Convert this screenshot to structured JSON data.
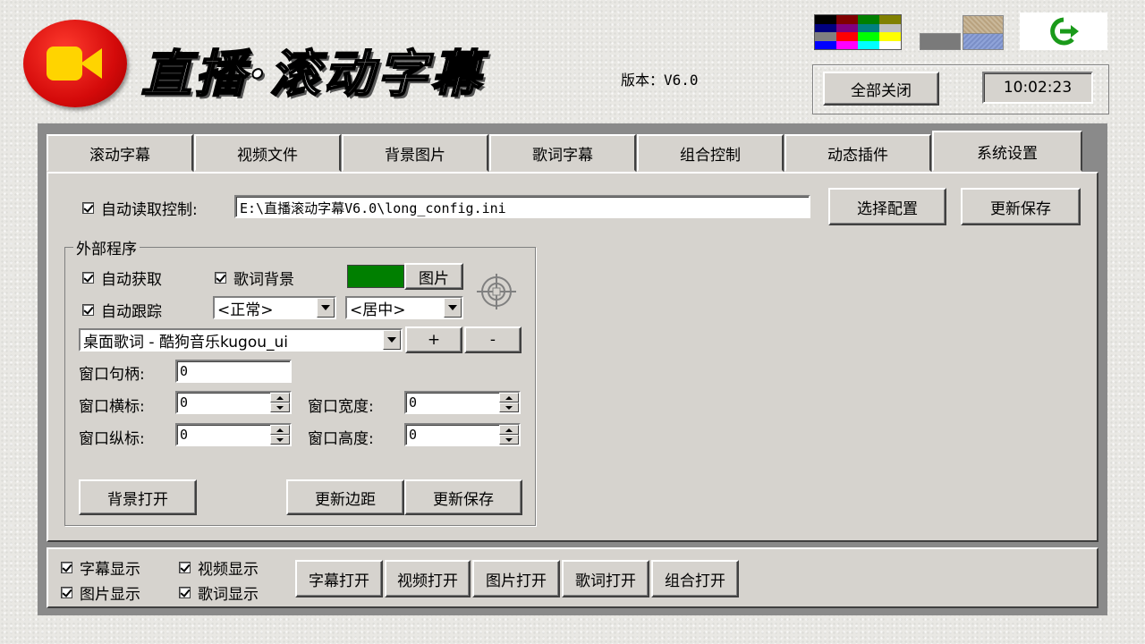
{
  "header": {
    "title": "直播·滚动字幕",
    "version_label": "版本：V6.0",
    "close_all_label": "全部关闭",
    "clock": "10:02:23"
  },
  "palette": {
    "colors": [
      "#000000",
      "#800000",
      "#008000",
      "#808000",
      "#000080",
      "#800080",
      "#008080",
      "#c0c0c0",
      "#808080",
      "#ff0000",
      "#00ff00",
      "#ffff00",
      "#0000ff",
      "#ff00ff",
      "#00ffff",
      "#ffffff"
    ]
  },
  "textures": {
    "icons": [
      "texture-sand",
      "texture-gray",
      "texture-blue"
    ]
  },
  "colors": {
    "lyric_bg": "#007f00",
    "logo_red": "#e01010",
    "logo_yellow": "#ffd400"
  },
  "tabs": [
    {
      "label": "滚动字幕"
    },
    {
      "label": "视频文件"
    },
    {
      "label": "背景图片"
    },
    {
      "label": "歌词字幕"
    },
    {
      "label": "组合控制"
    },
    {
      "label": "动态插件"
    },
    {
      "label": "系统设置"
    }
  ],
  "settings": {
    "auto_read_label": "自动读取控制:",
    "config_path": "E:\\直播滚动字幕V6.0\\long_config.ini",
    "select_config_label": "选择配置",
    "update_save_label": "更新保存"
  },
  "external": {
    "group_title": "外部程序",
    "auto_fetch_label": "自动获取",
    "lyric_bg_label": "歌词背景",
    "image_label": "图片",
    "auto_track_label": "自动跟踪",
    "mode_value": "<正常>",
    "align_value": "<居中>",
    "program_value": "桌面歌词 - 酷狗音乐kugou_ui",
    "plus_label": "+",
    "minus_label": "-",
    "handle_label": "窗口句柄:",
    "handle_value": "0",
    "x_label": "窗口横标:",
    "x_value": "0",
    "width_label": "窗口宽度:",
    "width_value": "0",
    "y_label": "窗口纵标:",
    "y_value": "0",
    "height_label": "窗口高度:",
    "height_value": "0",
    "bg_open_label": "背景打开",
    "update_margin_label": "更新边距",
    "update_save_label": "更新保存"
  },
  "bottom": {
    "subtitle_show": "字幕显示",
    "video_show": "视频显示",
    "image_show": "图片显示",
    "lyric_show": "歌词显示",
    "subtitle_open": "字幕打开",
    "video_open": "视频打开",
    "image_open": "图片打开",
    "lyric_open": "歌词打开",
    "combo_open": "组合打开"
  }
}
